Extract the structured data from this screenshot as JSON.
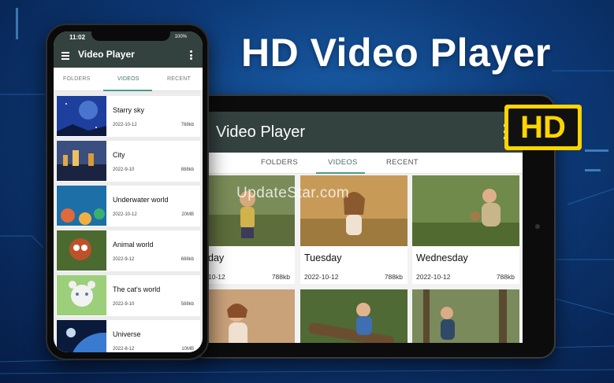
{
  "headline": "HD Video Player",
  "badge": "HD",
  "watermark": "UpdateStar.com",
  "colors": {
    "appbar": "#33413f",
    "tab_indicator": "#4d9a90",
    "badge_yellow": "#ffd400",
    "background_blue": "#0d3a78"
  },
  "phone": {
    "status": {
      "time": "11:02",
      "battery": "100%"
    },
    "app_title": "Video Player",
    "menu_icon": "hamburger-menu-icon",
    "more_icon": "more-vertical-icon",
    "tabs": [
      {
        "label": "FOLDERS",
        "active": false
      },
      {
        "label": "VIDEOS",
        "active": true
      },
      {
        "label": "RECENT",
        "active": false
      }
    ],
    "videos": [
      {
        "title": "Starry sky",
        "date": "2022-10-12",
        "size": "788kb"
      },
      {
        "title": "City",
        "date": "2022-9-10",
        "size": "888kb"
      },
      {
        "title": "Underwater world",
        "date": "2022-10-12",
        "size": "20MB"
      },
      {
        "title": "Animal world",
        "date": "2022-9-12",
        "size": "688kb"
      },
      {
        "title": "The cat's world",
        "date": "2022-9-10",
        "size": "588kb"
      },
      {
        "title": "Universe",
        "date": "2022-8-12",
        "size": "10MB"
      }
    ]
  },
  "tablet": {
    "app_title": "Video Player",
    "more_icon": "more-vertical-icon",
    "tabs": [
      {
        "label": "FOLDERS",
        "active": false
      },
      {
        "label": "VIDEOS",
        "active": true
      },
      {
        "label": "RECENT",
        "active": false
      }
    ],
    "videos": [
      {
        "title": "day",
        "date": "10-12",
        "size": "788kb"
      },
      {
        "title": "Tuesday",
        "date": "2022-10-12",
        "size": "788kb"
      },
      {
        "title": "Wednesday",
        "date": "2022-10-12",
        "size": "788kb"
      },
      {
        "title": "",
        "date": "",
        "size": ""
      },
      {
        "title": "",
        "date": "",
        "size": ""
      },
      {
        "title": "",
        "date": "",
        "size": ""
      }
    ]
  }
}
